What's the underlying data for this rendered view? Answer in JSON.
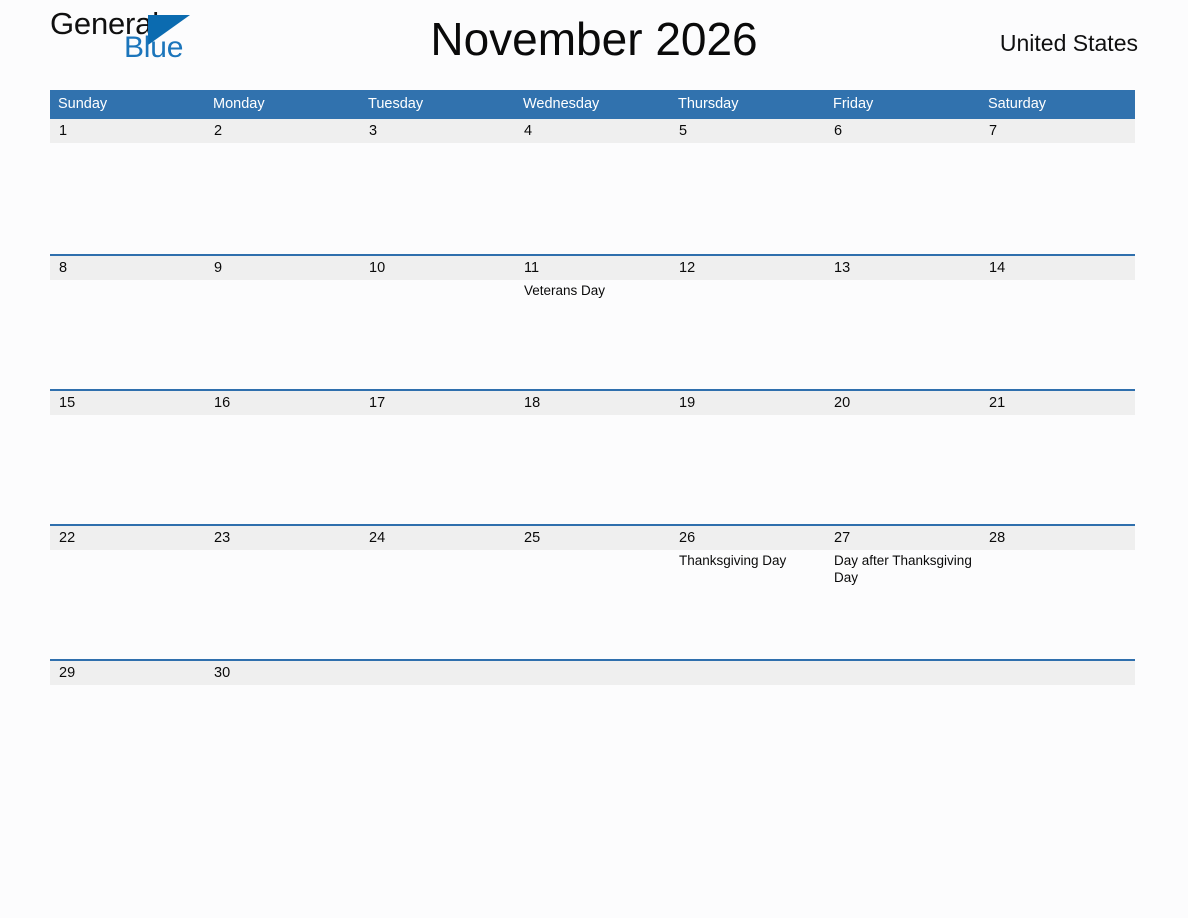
{
  "logo": {
    "text_top": "General",
    "text_bottom": "Blue",
    "triangle_icon": "triangle-icon",
    "color_top": "#101010",
    "color_bottom": "#1b75bb",
    "color_triangle": "#0b6bb0"
  },
  "header": {
    "title": "November 2026",
    "country": "United States"
  },
  "theme": {
    "header_blue": "#3172ae",
    "rule_blue": "#2f6fad",
    "band_gray": "#efefef",
    "page_background": "#fcfcfd",
    "text": "#0a0a0a"
  },
  "weekdays": [
    "Sunday",
    "Monday",
    "Tuesday",
    "Wednesday",
    "Thursday",
    "Friday",
    "Saturday"
  ],
  "weeks": [
    {
      "days": [
        {
          "number": "1",
          "holidays": []
        },
        {
          "number": "2",
          "holidays": []
        },
        {
          "number": "3",
          "holidays": []
        },
        {
          "number": "4",
          "holidays": []
        },
        {
          "number": "5",
          "holidays": []
        },
        {
          "number": "6",
          "holidays": []
        },
        {
          "number": "7",
          "holidays": []
        }
      ]
    },
    {
      "days": [
        {
          "number": "8",
          "holidays": []
        },
        {
          "number": "9",
          "holidays": []
        },
        {
          "number": "10",
          "holidays": []
        },
        {
          "number": "11",
          "holidays": [
            "Veterans Day"
          ]
        },
        {
          "number": "12",
          "holidays": []
        },
        {
          "number": "13",
          "holidays": []
        },
        {
          "number": "14",
          "holidays": []
        }
      ]
    },
    {
      "days": [
        {
          "number": "15",
          "holidays": []
        },
        {
          "number": "16",
          "holidays": []
        },
        {
          "number": "17",
          "holidays": []
        },
        {
          "number": "18",
          "holidays": []
        },
        {
          "number": "19",
          "holidays": []
        },
        {
          "number": "20",
          "holidays": []
        },
        {
          "number": "21",
          "holidays": []
        }
      ]
    },
    {
      "days": [
        {
          "number": "22",
          "holidays": []
        },
        {
          "number": "23",
          "holidays": []
        },
        {
          "number": "24",
          "holidays": []
        },
        {
          "number": "25",
          "holidays": []
        },
        {
          "number": "26",
          "holidays": [
            "Thanksgiving Day"
          ]
        },
        {
          "number": "27",
          "holidays": [
            "Day after Thanksgiving Day"
          ]
        },
        {
          "number": "28",
          "holidays": []
        }
      ]
    },
    {
      "days": [
        {
          "number": "29",
          "holidays": []
        },
        {
          "number": "30",
          "holidays": []
        },
        {
          "number": "",
          "holidays": []
        },
        {
          "number": "",
          "holidays": []
        },
        {
          "number": "",
          "holidays": []
        },
        {
          "number": "",
          "holidays": []
        },
        {
          "number": "",
          "holidays": []
        }
      ]
    }
  ]
}
